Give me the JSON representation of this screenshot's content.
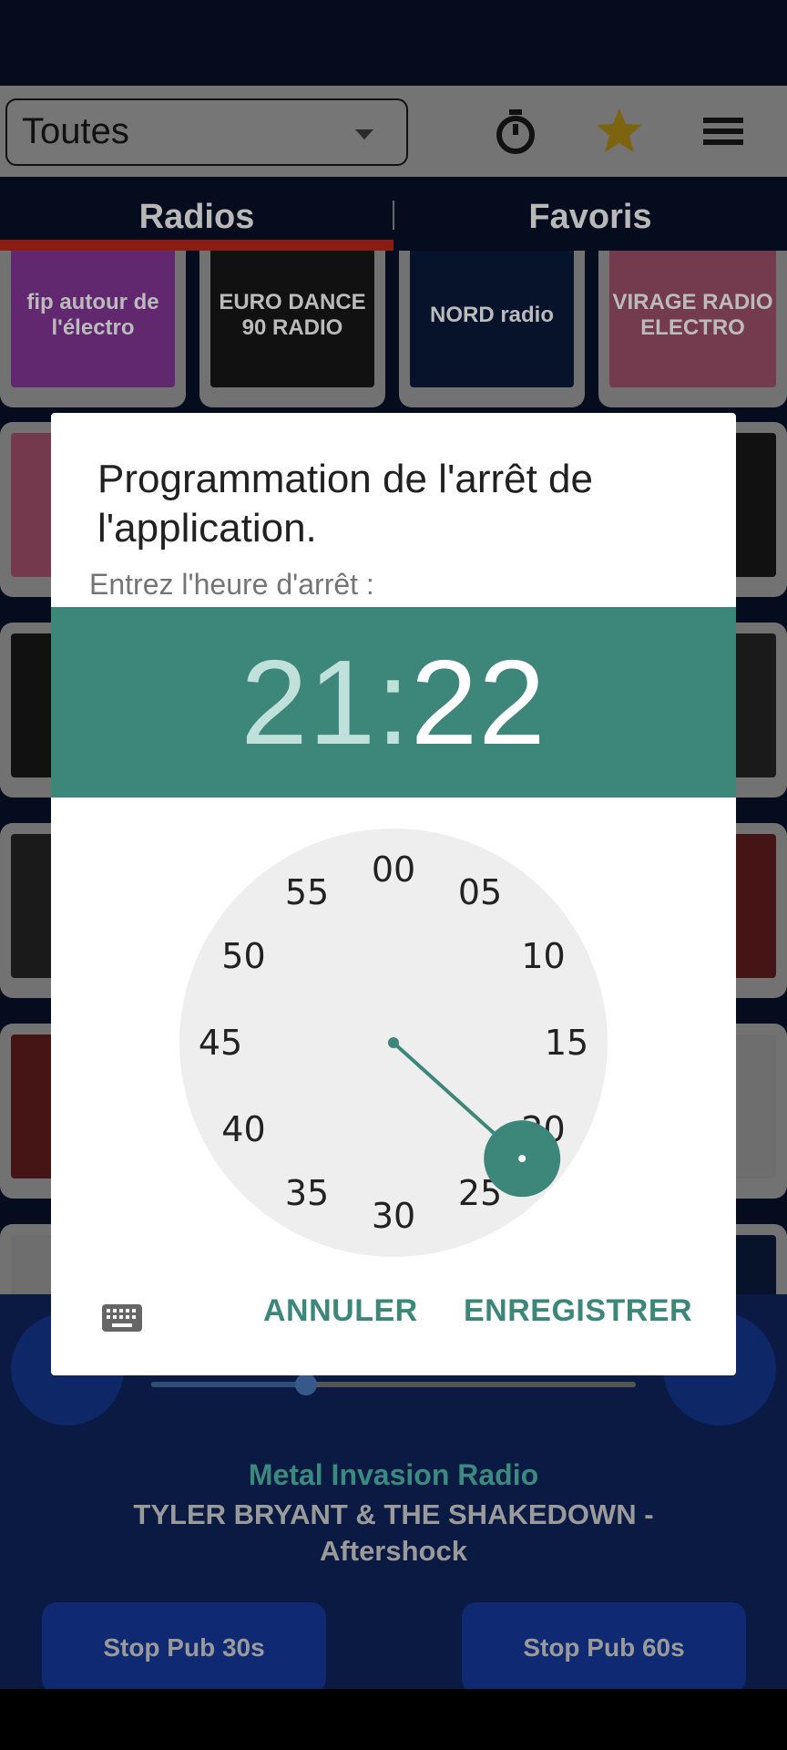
{
  "header": {
    "category_select": "Toutes",
    "icons": [
      "timer-icon",
      "star-icon",
      "menu-icon"
    ],
    "star_color": "#f5c518"
  },
  "tabs": [
    {
      "label": "Radios",
      "active": true
    },
    {
      "label": "Favoris",
      "active": false
    }
  ],
  "stations": [
    {
      "logo": "fip autour de l'électro",
      "color": "#c24fe0"
    },
    {
      "logo": "EURO DANCE 90 RADIO",
      "color": "#222"
    },
    {
      "logo": "NORD radio",
      "color": "#0d2552"
    },
    {
      "logo": "VIRAGE RADIO ELECTRO",
      "color": "#e8739a"
    }
  ],
  "player": {
    "station": "Metal Invasion Radio",
    "track": "TYLER BRYANT & THE SHAKEDOWN - Aftershock",
    "volume": 0.32,
    "stop_pub_30": "Stop Pub 30s",
    "stop_pub_60": "Stop Pub 60s"
  },
  "dialog": {
    "title": "Programmation de l'arrêt de l'application.",
    "subtitle": "Entrez l'heure d'arrêt :",
    "hour": "21",
    "separator": ":",
    "minute": "22",
    "selected_minute": 22,
    "clock_labels": [
      "00",
      "05",
      "10",
      "15",
      "20",
      "25",
      "30",
      "35",
      "40",
      "45",
      "50",
      "55"
    ],
    "cancel": "ANNULER",
    "save": "ENREGISTRER",
    "accent": "#3d877a"
  }
}
